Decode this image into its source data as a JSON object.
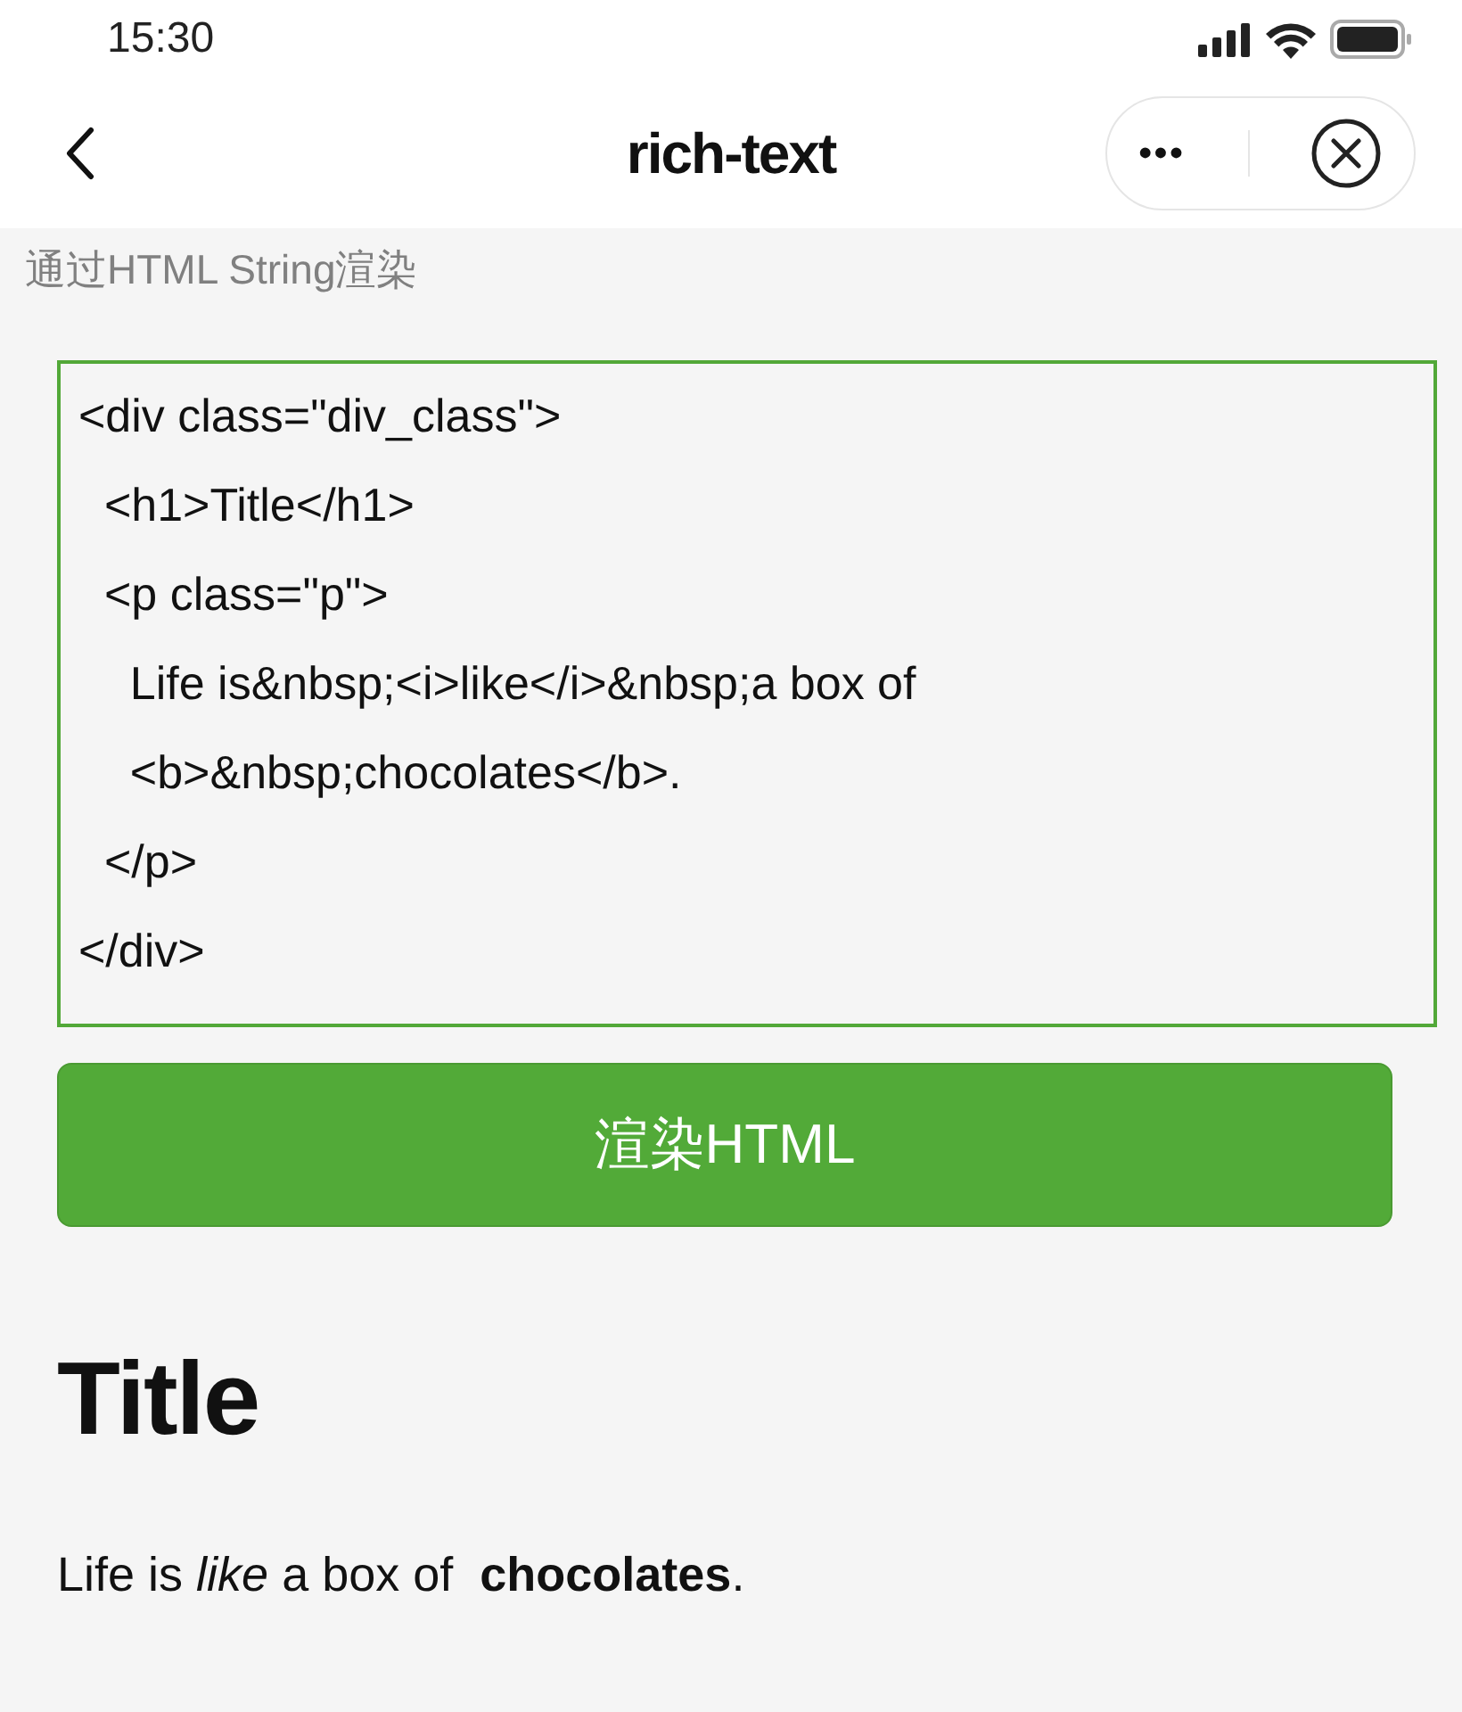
{
  "status_bar": {
    "time": "15:30"
  },
  "nav": {
    "title": "rich-text",
    "menu_glyph": "•••"
  },
  "section_label": "通过HTML String渲染",
  "editor": {
    "value": "<div class=\"div_class\">\n  <h1>Title</h1>\n  <p class=\"p\">\n    Life is&nbsp;<i>like</i>&nbsp;a box of\n    <b>&nbsp;chocolates</b>.\n  </p>\n</div>"
  },
  "render_button": "渲染HTML",
  "output": {
    "heading": "Title",
    "paragraph": "Life is *like* a box of  **chocolates**."
  }
}
